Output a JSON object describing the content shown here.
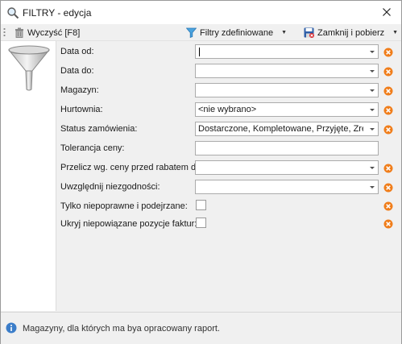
{
  "window": {
    "title": "FILTRY - edycja"
  },
  "toolbar": {
    "clear_label": "Wyczyść [F8]",
    "filters_label": "Filtry zdefiniowane",
    "close_label": "Zamknij i pobierz"
  },
  "form": {
    "rows": [
      {
        "label": "Data od:",
        "kind": "combo",
        "value": ""
      },
      {
        "label": "Data do:",
        "kind": "combo",
        "value": ""
      },
      {
        "label": "Magazyn:",
        "kind": "combo",
        "value": ""
      },
      {
        "label": "Hurtownia:",
        "kind": "combo",
        "value": "<nie wybrano>"
      },
      {
        "label": "Status zamówienia:",
        "kind": "combo",
        "value": "Dostarczone, Kompletowane, Przyjęte, Zrealiz..."
      },
      {
        "label": "Tolerancja ceny:",
        "kind": "text",
        "value": ""
      },
      {
        "label": "Przelicz wg. ceny przed rabatem dla:",
        "kind": "combo",
        "value": ""
      },
      {
        "label": "Uwzględnij niezgodności:",
        "kind": "combo",
        "value": ""
      },
      {
        "label": "Tylko niepoprawne i podejrzane:",
        "kind": "checkbox",
        "checked": false
      },
      {
        "label": "Ukryj niepowiązane pozycje faktur:",
        "kind": "checkbox",
        "checked": false
      }
    ]
  },
  "status": {
    "text": "Magazyny, dla których ma bya opracowany raport."
  },
  "colors": {
    "clear_icon": "#f07d1a",
    "info_icon": "#3b7dc9",
    "background": "#f0f0f0"
  }
}
